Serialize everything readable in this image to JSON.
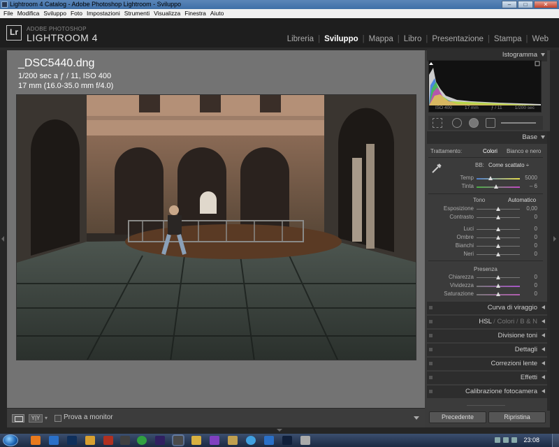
{
  "window": {
    "title": "Lightroom 4 Catalog - Adobe Photoshop Lightroom - Sviluppo",
    "buttons": {
      "minimize": "–",
      "maximize": "□",
      "close": "✕"
    }
  },
  "menu": [
    "File",
    "Modifica",
    "Sviluppo",
    "Foto",
    "Impostazioni",
    "Strumenti",
    "Visualizza",
    "Finestra",
    "Aiuto"
  ],
  "identity": {
    "logo": "Lr",
    "brand_top": "ADOBE PHOTOSHOP",
    "brand_main": "LIGHTROOM 4",
    "modules": [
      {
        "label": "Libreria",
        "active": false
      },
      {
        "label": "Sviluppo",
        "active": true
      },
      {
        "label": "Mappa",
        "active": false
      },
      {
        "label": "Libro",
        "active": false
      },
      {
        "label": "Presentazione",
        "active": false
      },
      {
        "label": "Stampa",
        "active": false
      },
      {
        "label": "Web",
        "active": false
      }
    ]
  },
  "image_info": {
    "filename": "_DSC5440.dng",
    "exposure": "1/200 sec a ƒ / 11, ISO 400",
    "lens": "17 mm (16.0-35.0 mm f/4.0)"
  },
  "toolbar": {
    "view_yy": "Y|Y",
    "soft_proof": "Prova a monitor"
  },
  "histogram": {
    "title": "Istogramma",
    "iso": "ISO 400",
    "focal": "17 mm",
    "aperture": "ƒ / 11",
    "shutter": "1/200 sec"
  },
  "basic": {
    "title": "Base",
    "treatment_label": "Trattamento:",
    "treatment_color": "Colori",
    "treatment_bw": "Bianco e nero",
    "wb_label": "BB:",
    "wb_value": "Come scattato ÷",
    "temp": {
      "label": "Temp",
      "value": "5000",
      "pos": 0.33
    },
    "tint": {
      "label": "Tinta",
      "value": "– 6",
      "pos": 0.45
    },
    "tone_label": "Tono",
    "auto_label": "Automatico",
    "tone_sliders": [
      {
        "label": "Esposizione",
        "value": "0,00",
        "pos": 0.5
      },
      {
        "label": "Contrasto",
        "value": "0",
        "pos": 0.5
      },
      {
        "label": "Luci",
        "value": "0",
        "pos": 0.5
      },
      {
        "label": "Ombre",
        "value": "0",
        "pos": 0.5
      },
      {
        "label": "Bianchi",
        "value": "0",
        "pos": 0.5
      },
      {
        "label": "Neri",
        "value": "0",
        "pos": 0.5
      }
    ],
    "presence_label": "Presenza",
    "presence_sliders": [
      {
        "label": "Chiarezza",
        "value": "0",
        "pos": 0.5
      },
      {
        "label": "Vividezza",
        "value": "0",
        "pos": 0.5
      },
      {
        "label": "Saturazione",
        "value": "0",
        "pos": 0.5
      }
    ]
  },
  "panels": {
    "tone_curve": "Curva di viraggio",
    "hsl_1": "HSL",
    "hsl_2": "Colori",
    "hsl_3": "B & N",
    "split": "Divisione toni",
    "detail": "Dettagli",
    "lens": "Correzioni lente",
    "effects": "Effetti",
    "calibration": "Calibrazione fotocamera",
    "hsl_sep": "/"
  },
  "buttons": {
    "previous": "Precedente",
    "reset": "Ripristina"
  },
  "taskbar": {
    "clock": "23:08"
  }
}
